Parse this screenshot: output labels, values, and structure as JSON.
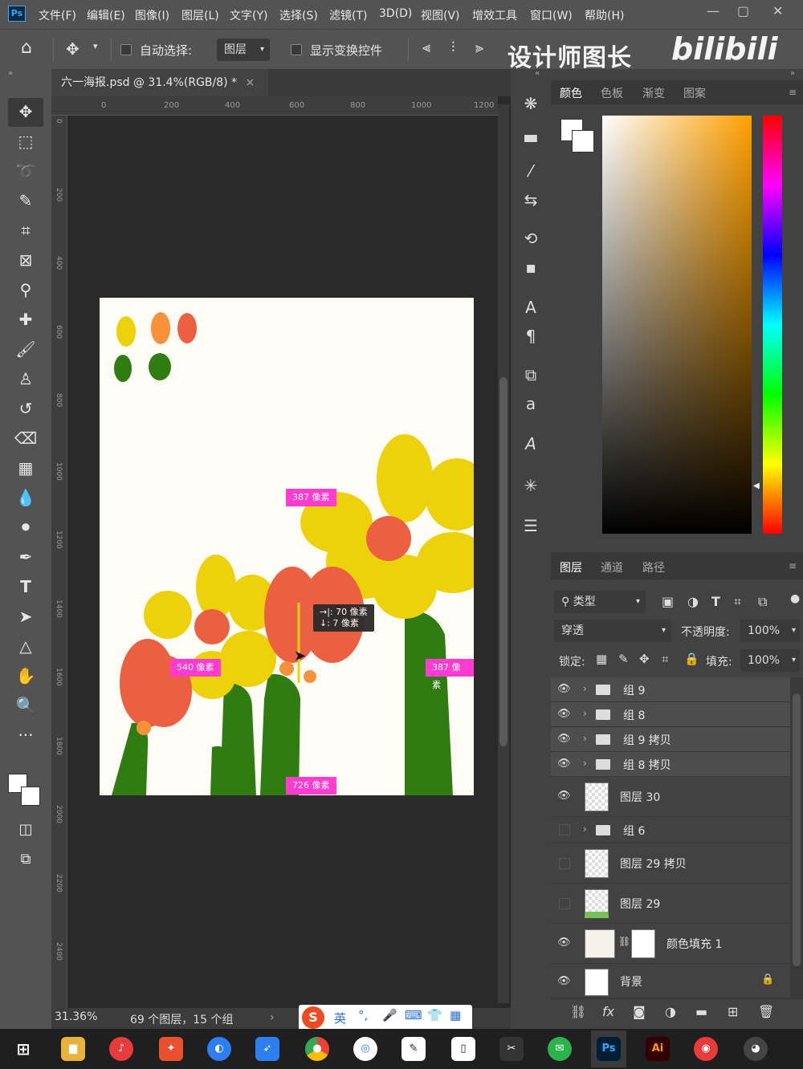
{
  "app": {
    "logo": "Ps",
    "menu": [
      "文件(F)",
      "编辑(E)",
      "图像(I)",
      "图层(L)",
      "文字(Y)",
      "选择(S)",
      "滤镜(T)",
      "3D(D)",
      "视图(V)",
      "增效工具",
      "窗口(W)",
      "帮助(H)"
    ],
    "window_controls": [
      "—",
      "▢",
      "✕"
    ]
  },
  "options": {
    "auto_select_label": "自动选择:",
    "layer_dropdown": "图层",
    "show_transform_label": "显示变换控件"
  },
  "watermark": {
    "text1": "设计师图长",
    "text2": "bilibili"
  },
  "document": {
    "tab_title": "六一海报.psd @ 31.4%(RGB/8) *",
    "tab_close": "×",
    "ruler_top": [
      "0",
      "200",
      "400",
      "600",
      "800",
      "1000",
      "1200"
    ],
    "ruler_left": [
      "0",
      "200",
      "400",
      "600",
      "800",
      "1000",
      "1200",
      "1400",
      "1600",
      "1800",
      "2000",
      "2200",
      "2400"
    ],
    "guides": {
      "tag_top": "387 像素",
      "tag_left": "540 像素",
      "tag_right": "387 像素",
      "tag_bottom": "726 像素",
      "tip_line1": "→|: 70 像素",
      "tip_line2": "↓: 7 像素"
    }
  },
  "status": {
    "zoom": "31.36%",
    "layers_info": "69 个图层，15 个组"
  },
  "color_panel": {
    "tabs": [
      "颜色",
      "色板",
      "渐变",
      "图案"
    ]
  },
  "layers_panel": {
    "tabs": [
      "图层",
      "通道",
      "路径"
    ],
    "filter_label": "类型",
    "blend_mode": "穿透",
    "opacity_label": "不透明度:",
    "opacity_value": "100%",
    "lock_label": "锁定:",
    "fill_label": "填充:",
    "fill_value": "100%",
    "layers": [
      {
        "name": "组 9",
        "type": "group",
        "visible": true
      },
      {
        "name": "组 8",
        "type": "group",
        "visible": true
      },
      {
        "name": "组 9 拷贝",
        "type": "group",
        "visible": true
      },
      {
        "name": "组 8 拷贝",
        "type": "group",
        "visible": true
      },
      {
        "name": "图层 30",
        "type": "layer",
        "visible": true
      },
      {
        "name": "组 6",
        "type": "group",
        "visible": false
      },
      {
        "name": "图层 29 拷贝",
        "type": "layer",
        "visible": false
      },
      {
        "name": "图层 29",
        "type": "layer",
        "visible": false
      },
      {
        "name": "颜色填充 1",
        "type": "fill",
        "visible": true
      },
      {
        "name": "背景",
        "type": "background",
        "visible": true
      }
    ]
  },
  "ime": {
    "label": "英"
  },
  "taskbar": {
    "apps": [
      "Ps",
      "Ai"
    ]
  },
  "colors": {
    "panel": "#424242",
    "canvas": "#fffcf5",
    "guide_tag": "#ff3ccf",
    "flower_yellow": "#edd10a",
    "flower_red": "#ec6042",
    "leaf_green": "#2f7d12"
  }
}
